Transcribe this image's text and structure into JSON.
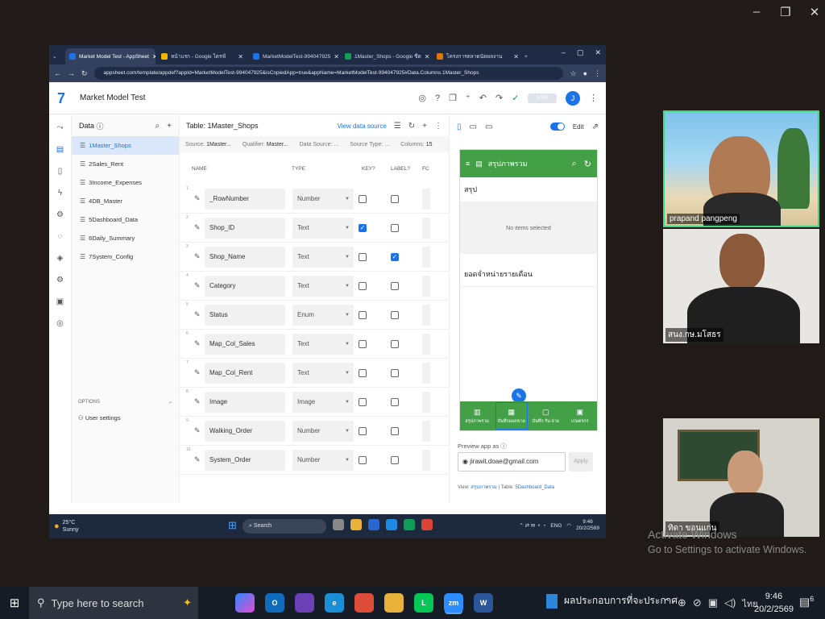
{
  "screen_share": {
    "browser": {
      "tabs": [
        {
          "label": "Market Model Test - AppSheet",
          "color": "#1a73e8"
        },
        {
          "label": "หน้าแรก - Google ไดรฟ์",
          "color": "#f4b400"
        },
        {
          "label": "MarketModelTest-994047925",
          "color": "#1a73e8"
        },
        {
          "label": "1Master_Shops - Google ชีต",
          "color": "#0f9d58"
        },
        {
          "label": "โครงการตลาดนัดผลงาน",
          "color": "#e37400"
        }
      ],
      "url": "appsheet.com/template/appdef?appId=MarketModelTest-994047925&isCopiedApp=true&appName=MarketModelTest-994047925#Data.Columns.1Master_Shops"
    },
    "app": {
      "title": "Market Model Test",
      "save_label": "SAVE",
      "avatar": "J"
    },
    "data_panel": {
      "title": "Data",
      "tables": [
        "1Master_Shops",
        "2Sales_Rent",
        "3Income_Expenses",
        "4DB_Master",
        "5Dashboard_Data",
        "6Daily_Summary",
        "7System_Config"
      ],
      "options_label": "OPTIONS",
      "user_settings": "User settings"
    },
    "table_panel": {
      "title": "Table: 1Master_Shops",
      "view_source": "View data source",
      "meta": {
        "source_label": "Source:",
        "source": "1Master...",
        "qualifier_label": "Qualifier:",
        "qualifier": "Master...",
        "datasource_label": "Data Source: ...",
        "sourcetype_label": "Source Type: ...",
        "columns_label": "Columns:",
        "columns": "15"
      },
      "headers": {
        "name": "NAME",
        "type": "TYPE",
        "key": "KEY?",
        "label": "LABEL?",
        "fc": "FC"
      },
      "rows": [
        {
          "num": "1",
          "name": "_RowNumber",
          "type": "Number",
          "key": false,
          "label": false
        },
        {
          "num": "2",
          "name": "Shop_ID",
          "type": "Text",
          "key": true,
          "label": false
        },
        {
          "num": "3",
          "name": "Shop_Name",
          "type": "Text",
          "key": false,
          "label": true
        },
        {
          "num": "4",
          "name": "Category",
          "type": "Text",
          "key": false,
          "label": false
        },
        {
          "num": "5",
          "name": "Status",
          "type": "Enum",
          "key": false,
          "label": false
        },
        {
          "num": "6",
          "name": "Map_Col_Sales",
          "type": "Text",
          "key": false,
          "label": false
        },
        {
          "num": "7",
          "name": "Map_Col_Rent",
          "type": "Text",
          "key": false,
          "label": false
        },
        {
          "num": "8",
          "name": "Image",
          "type": "Image",
          "key": false,
          "label": false
        },
        {
          "num": "9",
          "name": "Walking_Order",
          "type": "Number",
          "key": false,
          "label": false
        },
        {
          "num": "10",
          "name": "System_Order",
          "type": "Number",
          "key": false,
          "label": false
        }
      ]
    },
    "preview": {
      "edit_label": "Edit",
      "phone_title": "สรุปภาพรวม",
      "section1": "สรุป",
      "no_items": "No items selected",
      "section2": "ยอดจำหน่ายรายเดือน",
      "nav": [
        "สรุปภาพรวม",
        "บันทึกยอดขาย",
        "บันทึก รับ-จ่าย",
        "เกษตรกร"
      ],
      "preview_as_label": "Preview app as",
      "email": "jirawit.doae@gmail.com",
      "apply": "Apply",
      "view_label": "View:",
      "view_value": "สรุปภาพรวม",
      "table_label": "Table:",
      "table_value": "5Dashboard_Data"
    },
    "taskbar": {
      "weather_temp": "25°C",
      "weather_text": "Sunny",
      "search": "Search",
      "lang": "ENG",
      "time": "9:46",
      "date": "20/2/2569"
    }
  },
  "participants": [
    {
      "name": "prapand pangpeng"
    },
    {
      "name": "สนง.กษ.มโสธร"
    },
    {
      "name": "ทิดา ขอนแก่น"
    }
  ],
  "watermark": {
    "line1": "Activate Windows",
    "line2": "Go to Settings to activate Windows."
  },
  "windows_taskbar": {
    "search_placeholder": "Type here to search",
    "notification_text": "ผลประกอบการที่จะประกาศ",
    "lang": "ไทย",
    "time": "9:46",
    "date": "20/2/2569",
    "badge": "6"
  }
}
